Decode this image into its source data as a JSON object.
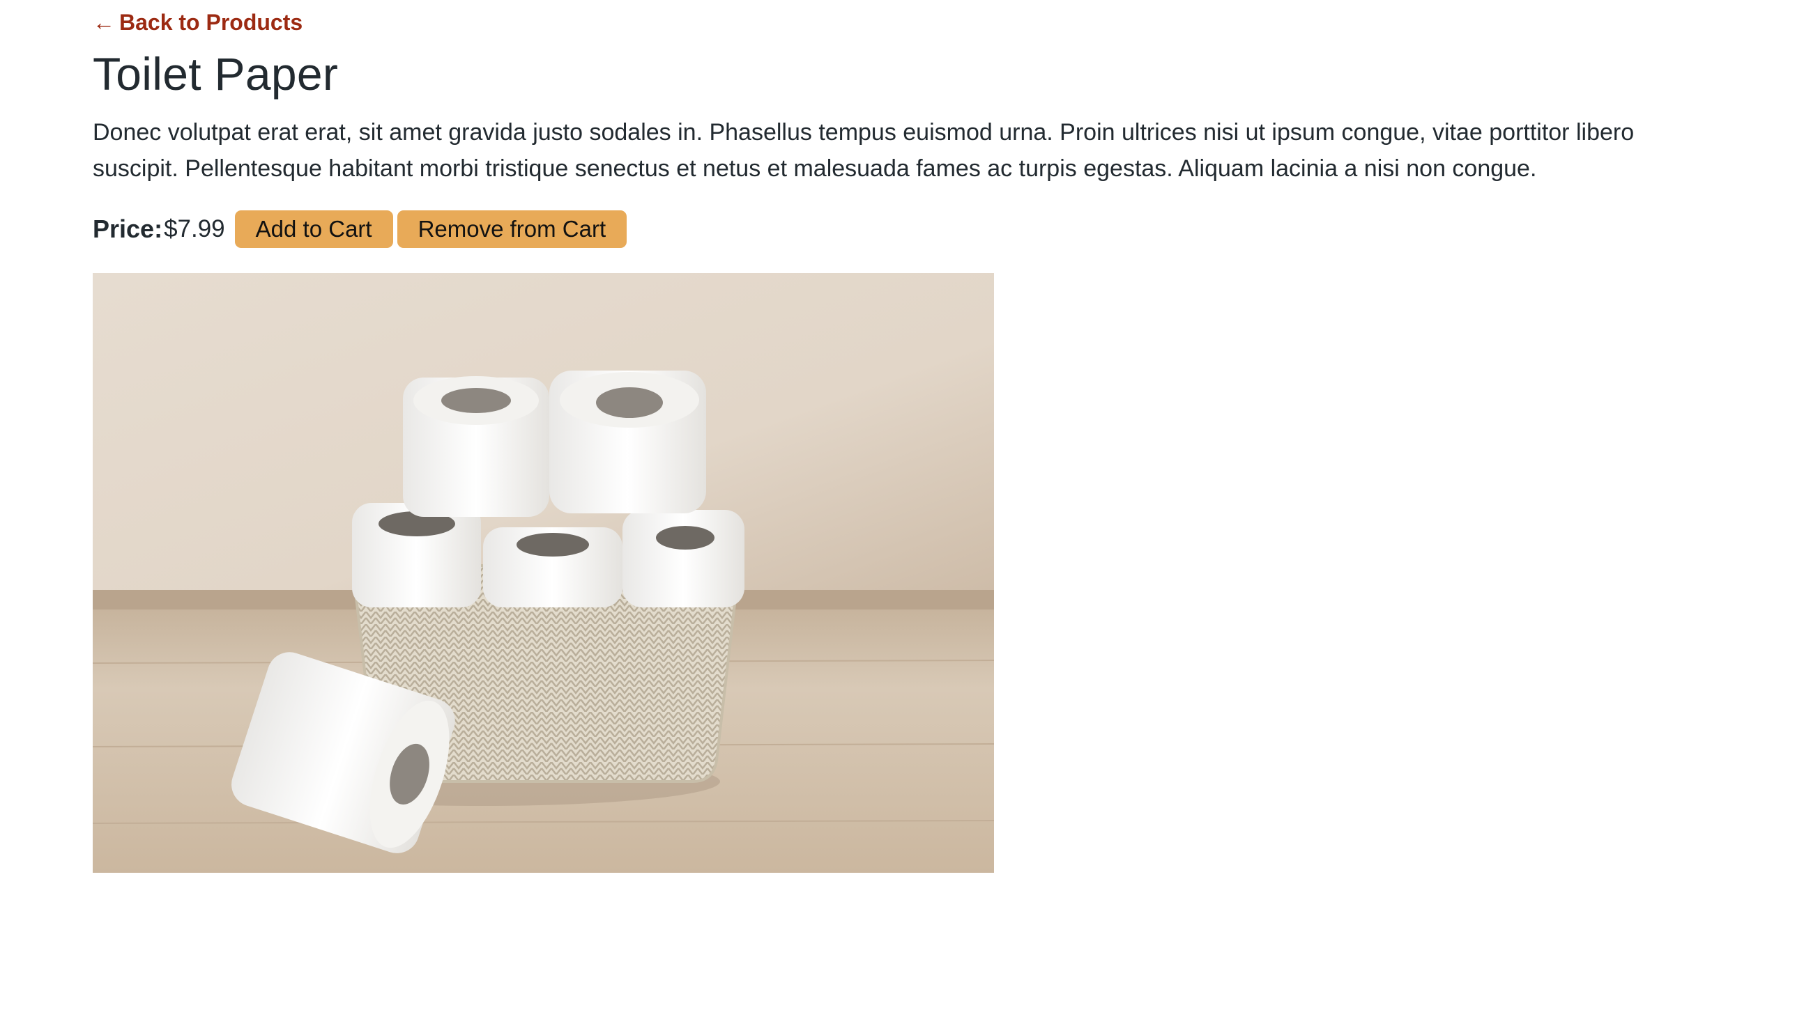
{
  "nav": {
    "back_arrow": "←",
    "back_label": "Back to Products"
  },
  "product": {
    "title": "Toilet Paper",
    "description": "Donec volutpat erat erat, sit amet gravida justo sodales in. Phasellus tempus euismod urna. Proin ultrices nisi ut ipsum congue, vitae porttitor libero suscipit. Pellentesque habitant morbi tristique senectus et netus et malesuada fames ac turpis egestas. Aliquam lacinia a nisi non congue.",
    "price_label": "Price:",
    "price_value": "$7.99",
    "image_icon": "product-photo-toilet-paper"
  },
  "actions": {
    "add_label": "Add to Cart",
    "remove_label": "Remove from Cart"
  },
  "colors": {
    "link": "#9c2a12",
    "button": "#e8aa58",
    "text": "#222a30"
  }
}
